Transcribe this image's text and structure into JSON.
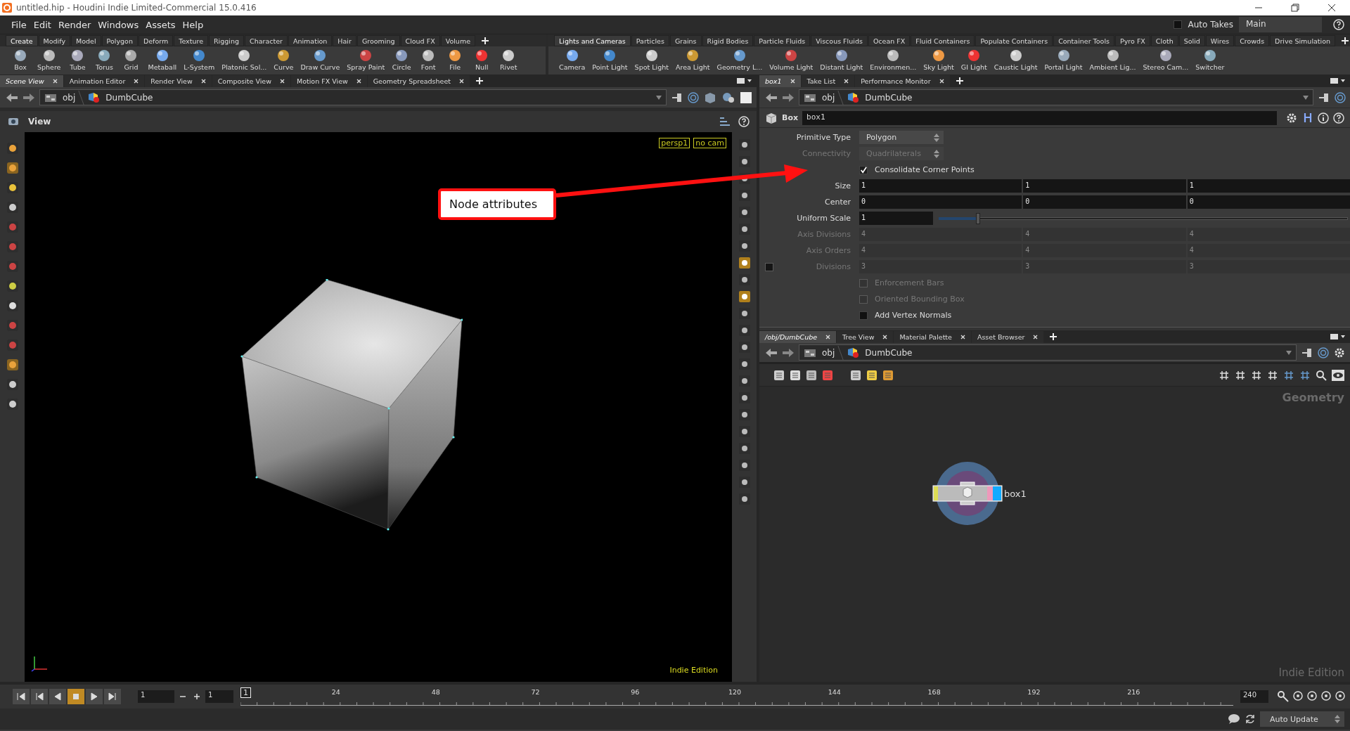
{
  "window": {
    "title": "untitled.hip - Houdini Indie Limited-Commercial 15.0.416"
  },
  "menu": [
    "File",
    "Edit",
    "Render",
    "Windows",
    "Assets",
    "Help"
  ],
  "auto_takes": {
    "label": "Auto Takes",
    "checked": false
  },
  "take": "Main",
  "shelves": [
    {
      "tabs": [
        {
          "label": "Create",
          "selected": true
        },
        {
          "label": "Modify",
          "selected": false
        },
        {
          "label": "Model",
          "selected": false
        },
        {
          "label": "Polygon",
          "selected": false
        },
        {
          "label": "Deform",
          "selected": false
        },
        {
          "label": "Texture",
          "selected": false
        },
        {
          "label": "Rigging",
          "selected": false
        },
        {
          "label": "Character",
          "selected": false
        },
        {
          "label": "Animation",
          "selected": false
        },
        {
          "label": "Hair",
          "selected": false
        },
        {
          "label": "Grooming",
          "selected": false
        },
        {
          "label": "Cloud FX",
          "selected": false
        },
        {
          "label": "Volume",
          "selected": false
        }
      ],
      "tools": [
        "Box",
        "Sphere",
        "Tube",
        "Torus",
        "Grid",
        "Metaball",
        "L-System",
        "Platonic Sol...",
        "Curve",
        "Draw Curve",
        "Spray Paint",
        "Circle",
        "Font",
        "File",
        "Null",
        "Rivet"
      ]
    },
    {
      "tabs": [
        {
          "label": "Lights and Cameras",
          "selected": true
        },
        {
          "label": "Particles",
          "selected": false
        },
        {
          "label": "Grains",
          "selected": false
        },
        {
          "label": "Rigid Bodies",
          "selected": false
        },
        {
          "label": "Particle Fluids",
          "selected": false
        },
        {
          "label": "Viscous Fluids",
          "selected": false
        },
        {
          "label": "Ocean FX",
          "selected": false
        },
        {
          "label": "Fluid Containers",
          "selected": false
        },
        {
          "label": "Populate Containers",
          "selected": false
        },
        {
          "label": "Container Tools",
          "selected": false
        },
        {
          "label": "Pyro FX",
          "selected": false
        },
        {
          "label": "Cloth",
          "selected": false
        },
        {
          "label": "Solid",
          "selected": false
        },
        {
          "label": "Wires",
          "selected": false
        },
        {
          "label": "Crowds",
          "selected": false
        },
        {
          "label": "Drive Simulation",
          "selected": false
        }
      ],
      "tools": [
        "Camera",
        "Point Light",
        "Spot Light",
        "Area Light",
        "Geometry L...",
        "Volume Light",
        "Distant Light",
        "Environmen...",
        "Sky Light",
        "GI Light",
        "Caustic Light",
        "Portal Light",
        "Ambient Lig...",
        "Stereo Cam...",
        "Switcher"
      ]
    }
  ],
  "scene_pane": {
    "tabs": [
      {
        "label": "Scene View",
        "selected": true
      },
      {
        "label": "Animation Editor",
        "selected": false
      },
      {
        "label": "Render View",
        "selected": false
      },
      {
        "label": "Composite View",
        "selected": false
      },
      {
        "label": "Motion FX View",
        "selected": false
      },
      {
        "label": "Geometry Spreadsheet",
        "selected": false
      }
    ],
    "path": [
      "obj",
      "DumbCube"
    ],
    "viewer_title": "View",
    "camera_menus": [
      "persp1",
      "no cam"
    ],
    "edition": "Indie Edition"
  },
  "annotation": {
    "text": "Node attributes"
  },
  "params_pane": {
    "tabs": [
      {
        "label": "box1",
        "selected": true
      },
      {
        "label": "Take List",
        "selected": false
      },
      {
        "label": "Performance Monitor",
        "selected": false
      }
    ],
    "path": [
      "obj",
      "DumbCube"
    ],
    "node_type": "Box",
    "node_name": "box1",
    "params": [
      {
        "kind": "menu",
        "label": "Primitive Type",
        "value": "Polygon",
        "disabled": false
      },
      {
        "kind": "menu",
        "label": "Connectivity",
        "value": "Quadrilaterals",
        "disabled": true
      },
      {
        "kind": "toggle",
        "label": "Consolidate Corner Points",
        "checked": true,
        "disabled": false
      },
      {
        "kind": "vector",
        "label": "Size",
        "values": [
          "1",
          "1",
          "1"
        ],
        "disabled": false
      },
      {
        "kind": "vector",
        "label": "Center",
        "values": [
          "0",
          "0",
          "0"
        ],
        "disabled": false
      },
      {
        "kind": "slider",
        "label": "Uniform Scale",
        "value": "1",
        "level": 0.1,
        "disabled": false
      },
      {
        "kind": "vector",
        "label": "Axis Divisions",
        "values": [
          "4",
          "4",
          "4"
        ],
        "disabled": true
      },
      {
        "kind": "vector",
        "label": "Axis Orders",
        "values": [
          "4",
          "4",
          "4"
        ],
        "disabled": true
      },
      {
        "kind": "vector",
        "label": "Divisions",
        "values": [
          "3",
          "3",
          "3"
        ],
        "disabled": true,
        "enabled_toggle": false
      },
      {
        "kind": "toggle",
        "label": "Enforcement Bars",
        "checked": false,
        "disabled": true
      },
      {
        "kind": "toggle",
        "label": "Oriented Bounding Box",
        "checked": false,
        "disabled": true
      },
      {
        "kind": "toggle",
        "label": "Add Vertex Normals",
        "checked": false,
        "disabled": false
      }
    ]
  },
  "network_pane": {
    "tabs": [
      {
        "label": "/obj/DumbCube",
        "selected": true
      },
      {
        "label": "Tree View",
        "selected": false
      },
      {
        "label": "Material Palette",
        "selected": false
      },
      {
        "label": "Asset Browser",
        "selected": false
      }
    ],
    "path": [
      "obj",
      "DumbCube"
    ],
    "context": "Geometry",
    "edition": "Indie Edition",
    "nodes": [
      {
        "name": "box1"
      }
    ]
  },
  "timeline": {
    "frame": "1",
    "start": "1",
    "marker": "1",
    "ticks": [
      "24",
      "48",
      "72",
      "96",
      "120",
      "144",
      "168",
      "192",
      "216"
    ],
    "end": "240"
  },
  "status": {
    "update_mode": "Auto Update"
  }
}
